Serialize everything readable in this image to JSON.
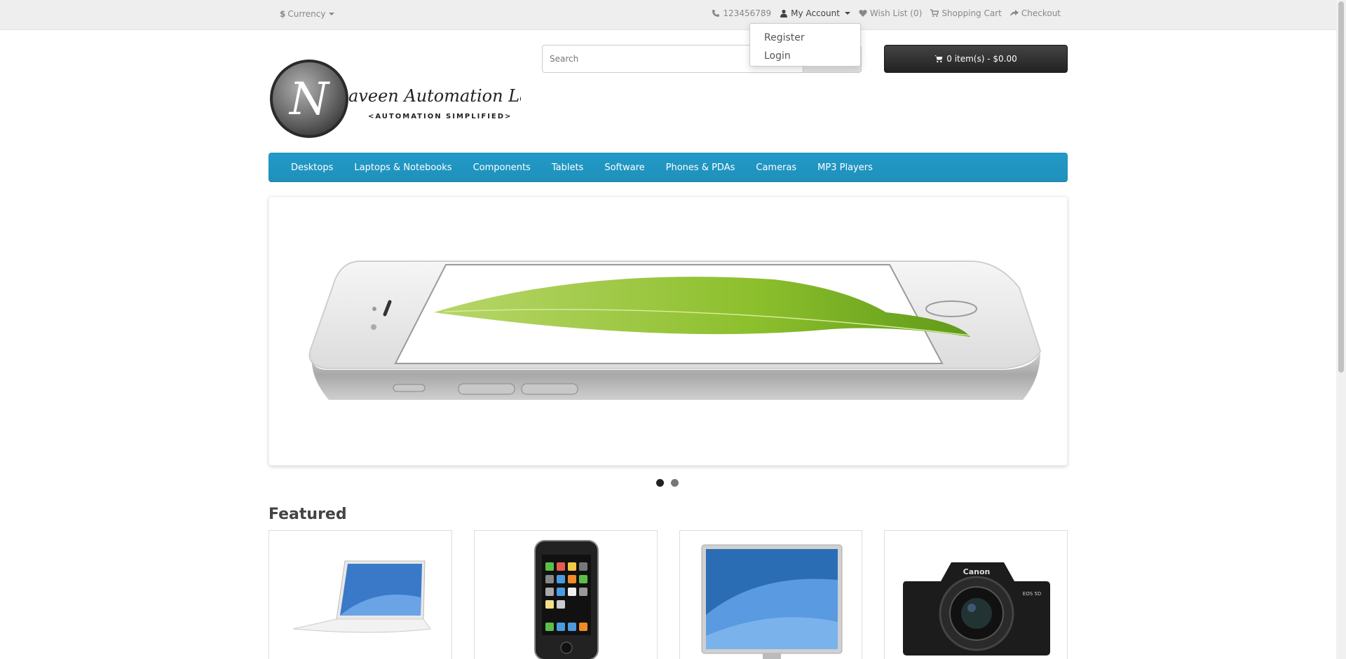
{
  "topbar": {
    "currency_label": "Currency",
    "currency_symbol": "$",
    "phone": "123456789",
    "my_account": "My Account",
    "wish_list": "Wish List (0)",
    "shopping_cart": "Shopping Cart",
    "checkout": "Checkout"
  },
  "account_dropdown": {
    "items": [
      "Register",
      "Login"
    ]
  },
  "header": {
    "logo_text": "aveen Automation Labs",
    "logo_initial": "N",
    "logo_tagline": "<AUTOMATION SIMPLIFIED>",
    "search_placeholder": "Search",
    "cart_label": "0 item(s) - $0.00"
  },
  "menu": {
    "items": [
      "Desktops",
      "Laptops & Notebooks",
      "Components",
      "Tablets",
      "Software",
      "Phones & PDAs",
      "Cameras",
      "MP3 Players"
    ]
  },
  "slideshow": {
    "slide_count": 2,
    "active_index": 0
  },
  "featured": {
    "title": "Featured",
    "products": [
      "laptop",
      "phone",
      "monitor",
      "camera"
    ],
    "camera_brand": "Canon",
    "camera_model": "EOS 5D"
  },
  "colors": {
    "menu_blue": "#229ac8",
    "cart_dark": "#333333",
    "topbar_bg": "#eeeeee"
  }
}
